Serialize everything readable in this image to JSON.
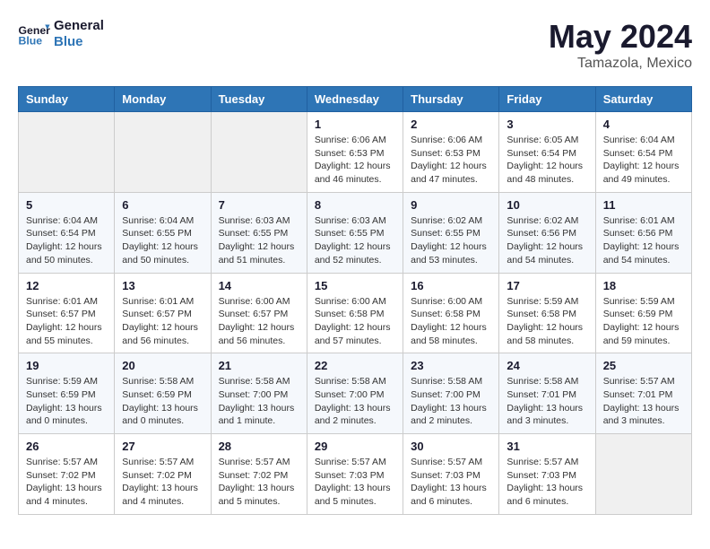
{
  "header": {
    "logo_line1": "General",
    "logo_line2": "Blue",
    "main_title": "May 2024",
    "subtitle": "Tamazola, Mexico"
  },
  "days_of_week": [
    "Sunday",
    "Monday",
    "Tuesday",
    "Wednesday",
    "Thursday",
    "Friday",
    "Saturday"
  ],
  "weeks": [
    [
      {
        "day": "",
        "info": ""
      },
      {
        "day": "",
        "info": ""
      },
      {
        "day": "",
        "info": ""
      },
      {
        "day": "1",
        "info": "Sunrise: 6:06 AM\nSunset: 6:53 PM\nDaylight: 12 hours and 46 minutes."
      },
      {
        "day": "2",
        "info": "Sunrise: 6:06 AM\nSunset: 6:53 PM\nDaylight: 12 hours and 47 minutes."
      },
      {
        "day": "3",
        "info": "Sunrise: 6:05 AM\nSunset: 6:54 PM\nDaylight: 12 hours and 48 minutes."
      },
      {
        "day": "4",
        "info": "Sunrise: 6:04 AM\nSunset: 6:54 PM\nDaylight: 12 hours and 49 minutes."
      }
    ],
    [
      {
        "day": "5",
        "info": "Sunrise: 6:04 AM\nSunset: 6:54 PM\nDaylight: 12 hours and 50 minutes."
      },
      {
        "day": "6",
        "info": "Sunrise: 6:04 AM\nSunset: 6:55 PM\nDaylight: 12 hours and 50 minutes."
      },
      {
        "day": "7",
        "info": "Sunrise: 6:03 AM\nSunset: 6:55 PM\nDaylight: 12 hours and 51 minutes."
      },
      {
        "day": "8",
        "info": "Sunrise: 6:03 AM\nSunset: 6:55 PM\nDaylight: 12 hours and 52 minutes."
      },
      {
        "day": "9",
        "info": "Sunrise: 6:02 AM\nSunset: 6:55 PM\nDaylight: 12 hours and 53 minutes."
      },
      {
        "day": "10",
        "info": "Sunrise: 6:02 AM\nSunset: 6:56 PM\nDaylight: 12 hours and 54 minutes."
      },
      {
        "day": "11",
        "info": "Sunrise: 6:01 AM\nSunset: 6:56 PM\nDaylight: 12 hours and 54 minutes."
      }
    ],
    [
      {
        "day": "12",
        "info": "Sunrise: 6:01 AM\nSunset: 6:57 PM\nDaylight: 12 hours and 55 minutes."
      },
      {
        "day": "13",
        "info": "Sunrise: 6:01 AM\nSunset: 6:57 PM\nDaylight: 12 hours and 56 minutes."
      },
      {
        "day": "14",
        "info": "Sunrise: 6:00 AM\nSunset: 6:57 PM\nDaylight: 12 hours and 56 minutes."
      },
      {
        "day": "15",
        "info": "Sunrise: 6:00 AM\nSunset: 6:58 PM\nDaylight: 12 hours and 57 minutes."
      },
      {
        "day": "16",
        "info": "Sunrise: 6:00 AM\nSunset: 6:58 PM\nDaylight: 12 hours and 58 minutes."
      },
      {
        "day": "17",
        "info": "Sunrise: 5:59 AM\nSunset: 6:58 PM\nDaylight: 12 hours and 58 minutes."
      },
      {
        "day": "18",
        "info": "Sunrise: 5:59 AM\nSunset: 6:59 PM\nDaylight: 12 hours and 59 minutes."
      }
    ],
    [
      {
        "day": "19",
        "info": "Sunrise: 5:59 AM\nSunset: 6:59 PM\nDaylight: 13 hours and 0 minutes."
      },
      {
        "day": "20",
        "info": "Sunrise: 5:58 AM\nSunset: 6:59 PM\nDaylight: 13 hours and 0 minutes."
      },
      {
        "day": "21",
        "info": "Sunrise: 5:58 AM\nSunset: 7:00 PM\nDaylight: 13 hours and 1 minute."
      },
      {
        "day": "22",
        "info": "Sunrise: 5:58 AM\nSunset: 7:00 PM\nDaylight: 13 hours and 2 minutes."
      },
      {
        "day": "23",
        "info": "Sunrise: 5:58 AM\nSunset: 7:00 PM\nDaylight: 13 hours and 2 minutes."
      },
      {
        "day": "24",
        "info": "Sunrise: 5:58 AM\nSunset: 7:01 PM\nDaylight: 13 hours and 3 minutes."
      },
      {
        "day": "25",
        "info": "Sunrise: 5:57 AM\nSunset: 7:01 PM\nDaylight: 13 hours and 3 minutes."
      }
    ],
    [
      {
        "day": "26",
        "info": "Sunrise: 5:57 AM\nSunset: 7:02 PM\nDaylight: 13 hours and 4 minutes."
      },
      {
        "day": "27",
        "info": "Sunrise: 5:57 AM\nSunset: 7:02 PM\nDaylight: 13 hours and 4 minutes."
      },
      {
        "day": "28",
        "info": "Sunrise: 5:57 AM\nSunset: 7:02 PM\nDaylight: 13 hours and 5 minutes."
      },
      {
        "day": "29",
        "info": "Sunrise: 5:57 AM\nSunset: 7:03 PM\nDaylight: 13 hours and 5 minutes."
      },
      {
        "day": "30",
        "info": "Sunrise: 5:57 AM\nSunset: 7:03 PM\nDaylight: 13 hours and 6 minutes."
      },
      {
        "day": "31",
        "info": "Sunrise: 5:57 AM\nSunset: 7:03 PM\nDaylight: 13 hours and 6 minutes."
      },
      {
        "day": "",
        "info": ""
      }
    ]
  ]
}
